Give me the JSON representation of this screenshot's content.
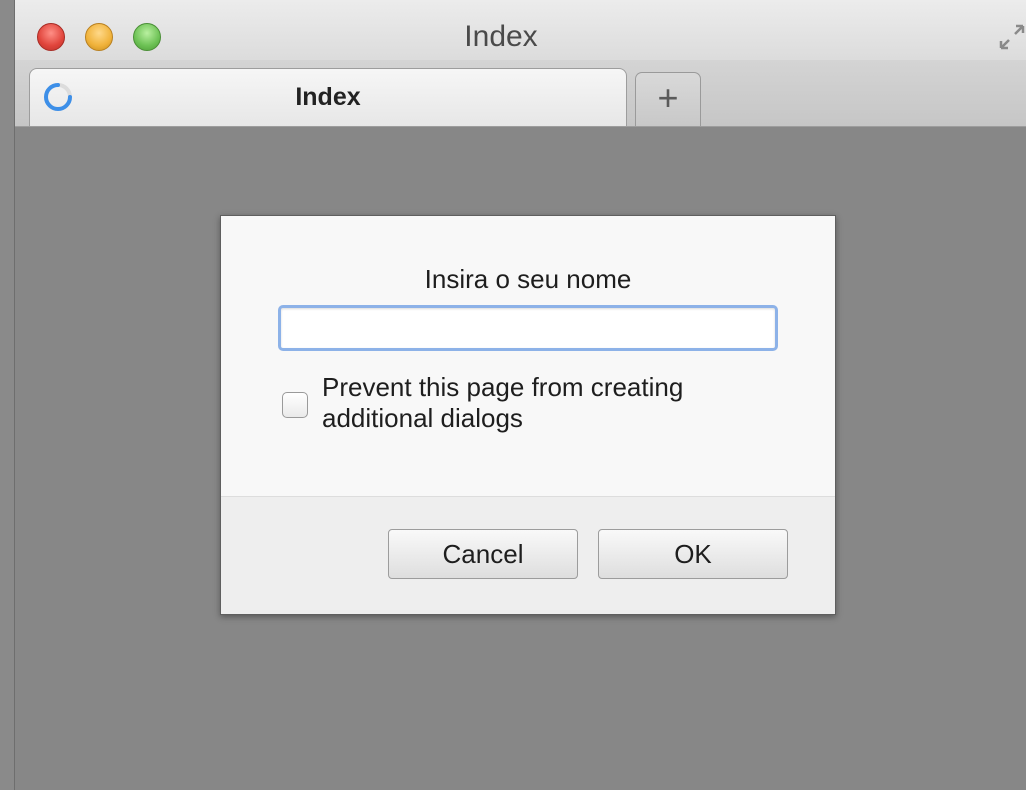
{
  "window": {
    "title": "Index"
  },
  "tabs": [
    {
      "label": "Index",
      "loading": true
    }
  ],
  "new_tab": {
    "label": "+"
  },
  "dialog": {
    "prompt": "Insira o seu nome",
    "input_value": "",
    "checkbox_label": "Prevent this page from creating additional dialogs",
    "checkbox_checked": false,
    "cancel_label": "Cancel",
    "ok_label": "OK"
  },
  "colors": {
    "close": "#e0443b",
    "minimize": "#f0b23a",
    "zoom": "#6cc154",
    "input_focus": "#8db2e8",
    "spinner": "#3d8fe8"
  },
  "icons": {
    "close": "close-button-icon",
    "minimize": "minimize-button-icon",
    "zoom": "zoom-button-icon",
    "fullscreen": "fullscreen-icon",
    "spinner": "loading-spinner-icon"
  }
}
